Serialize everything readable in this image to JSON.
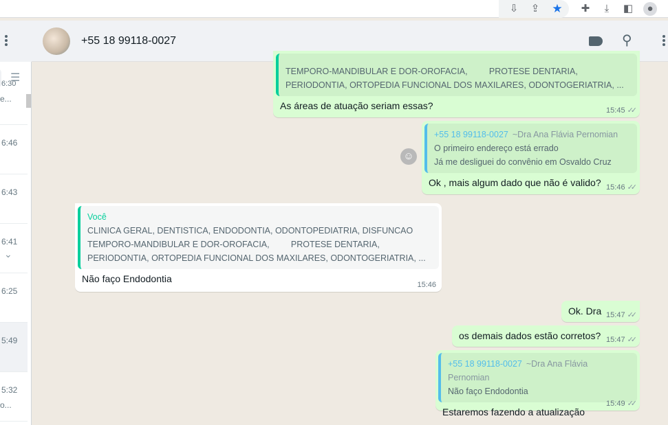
{
  "browser": {
    "icons": [
      "install-icon",
      "share-icon",
      "bookmark-star-icon",
      "extensions-icon",
      "downloads-icon",
      "side-panel-icon",
      "profile-icon"
    ],
    "accent": "#1a73e8"
  },
  "sidebar": {
    "partial_top": {
      "time": "6:30",
      "preview": "e..."
    },
    "items": [
      {
        "time": "6:46"
      },
      {
        "time": "6:43"
      },
      {
        "time": "6:41"
      },
      {
        "time": "6:25"
      },
      {
        "time": "5:49"
      },
      {
        "time": "5:32",
        "preview": "o..."
      }
    ]
  },
  "chat": {
    "contact": "+55 18 99118-0027",
    "messages": [
      {
        "dir": "out",
        "quote_lines": [
          "TEMPORO-MANDIBULAR E DOR-OROFACIA,         PROTESE DENTARIA,",
          "PERIODONTIA, ORTOPEDIA FUNCIONAL DOS MAXILARES, ODONTOGERIATRIA, ..."
        ],
        "text": "As áreas de atuação seriam essas?",
        "time": "15:45"
      },
      {
        "dir": "out",
        "quote_author": "+55 18 99118-0027",
        "quote_sub": "~Dra Ana Flávia Pernomian",
        "quote_lines": [
          "O primeiro endereço está errado",
          "Já me desliguei do convênio em Osvaldo Cruz"
        ],
        "text": "Ok , mais algum dado que não é valido?",
        "time": "15:46"
      },
      {
        "dir": "in",
        "quote_author": "Você",
        "quote_lines": [
          "CLINICA GERAL, DENTISTICA, ENDODONTIA, ODONTOPEDIATRIA, DISFUNCAO",
          "TEMPORO-MANDIBULAR E DOR-OROFACIA,         PROTESE DENTARIA,",
          "PERIODONTIA, ORTOPEDIA FUNCIONAL DOS MAXILARES, ODONTOGERIATRIA, ..."
        ],
        "text": "Não faço Endodontia",
        "time": "15:46"
      },
      {
        "dir": "out",
        "text": "Ok. Dra",
        "time": "15:47"
      },
      {
        "dir": "out",
        "text": "os demais dados estão corretos?",
        "time": "15:47"
      },
      {
        "dir": "out",
        "quote_author": "+55 18 99118-0027",
        "quote_sub": "~Dra Ana Flávia Pernomian",
        "quote_lines": [
          "Não faço Endodontia"
        ],
        "text": "Estaremos fazendo a atualização",
        "time": "15:49"
      }
    ],
    "ticks": "✓✓"
  }
}
